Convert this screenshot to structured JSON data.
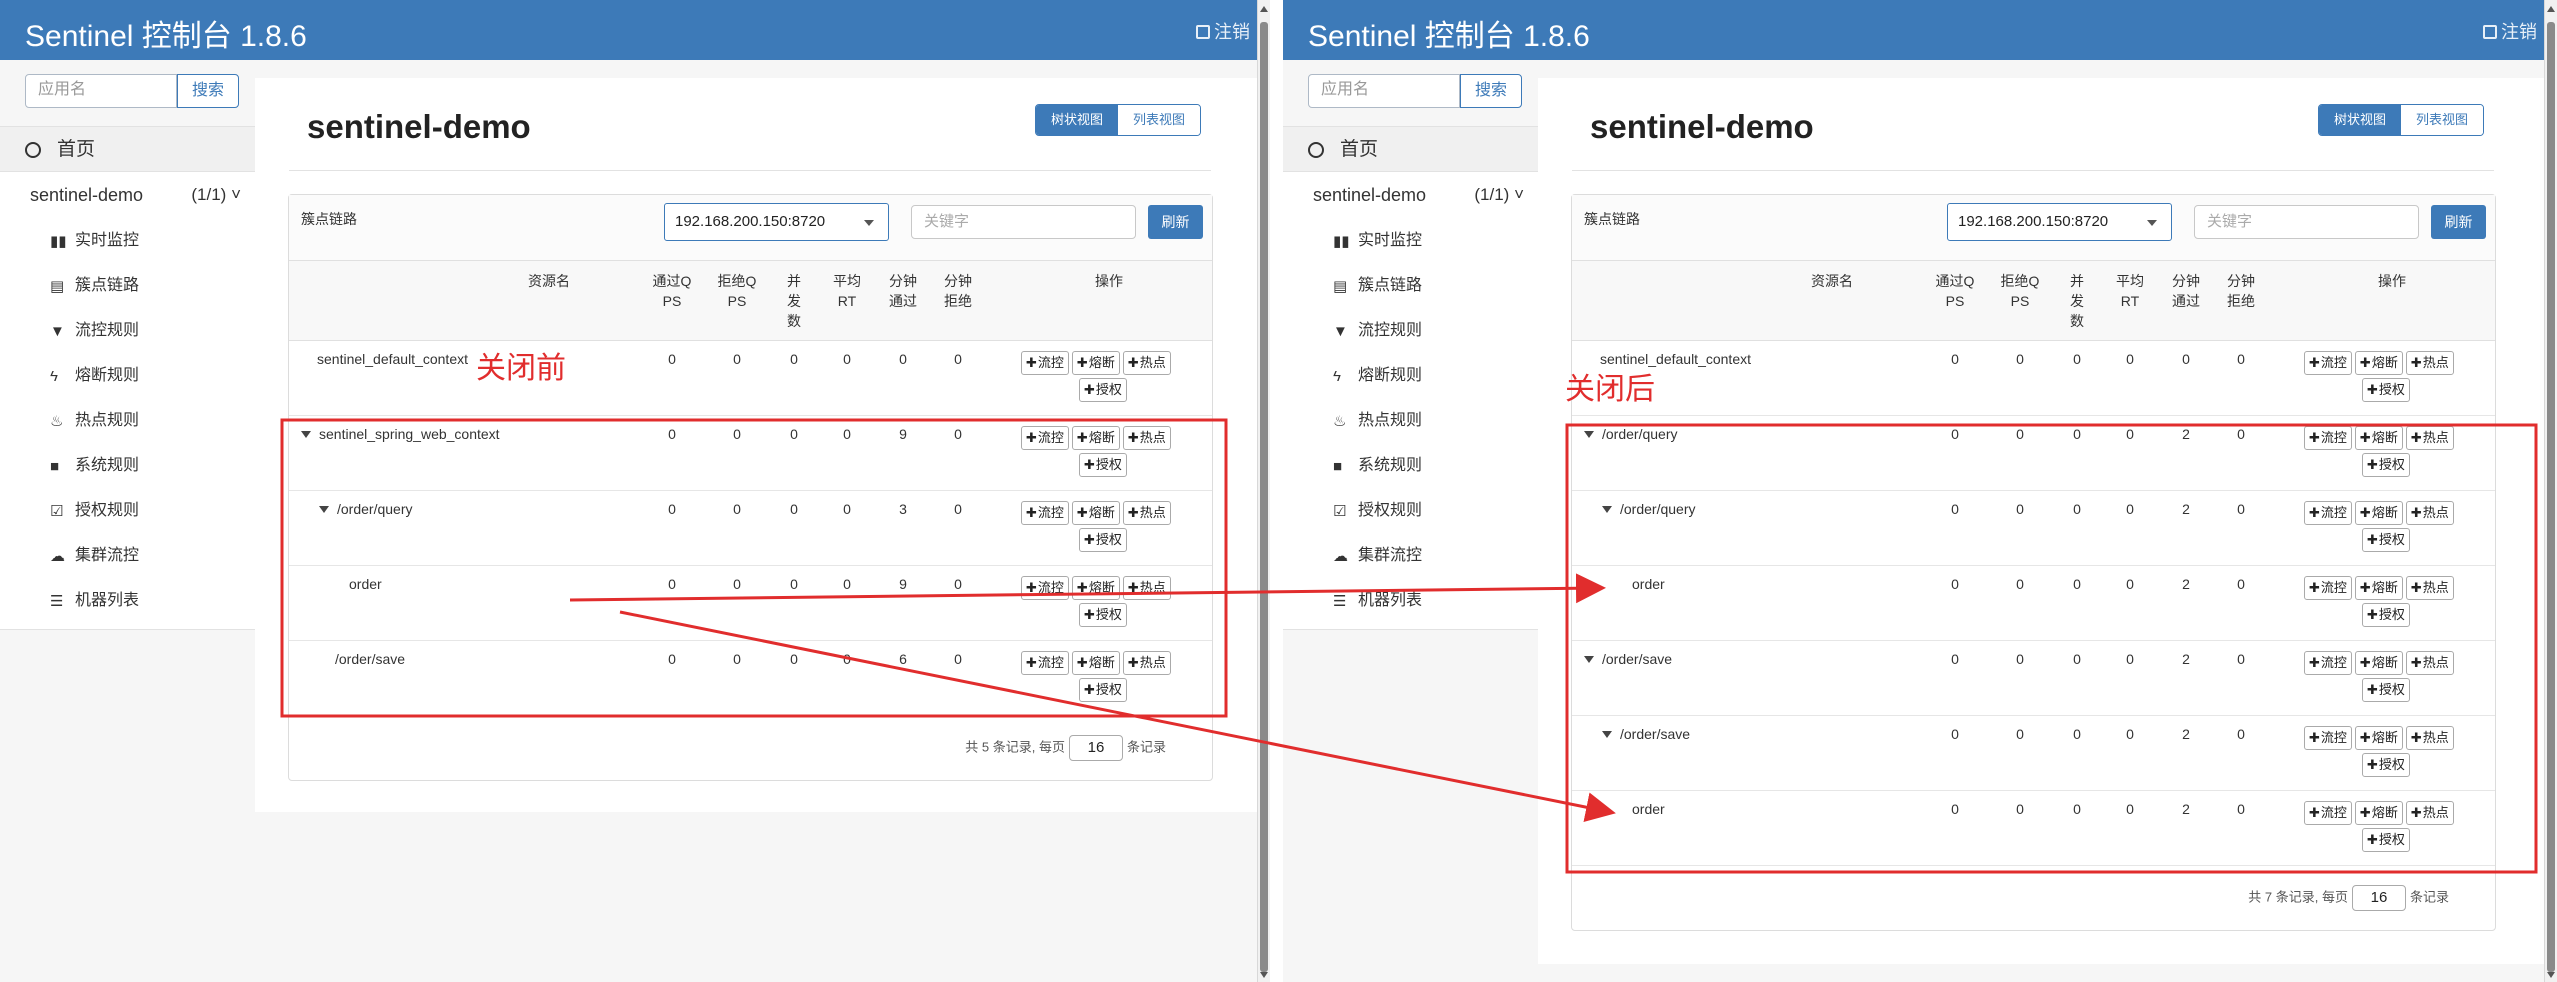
{
  "app": {
    "title": "Sentinel 控制台 1.8.6",
    "logout_label": "注销"
  },
  "sidebar": {
    "search_placeholder": "应用名",
    "search_button": "搜索",
    "home_label": "首页",
    "app_name": "sentinel-demo",
    "app_count": "(1/1)",
    "menu": [
      {
        "label": "实时监控",
        "icon": "bar-chart-icon"
      },
      {
        "label": "簇点链路",
        "icon": "list-icon"
      },
      {
        "label": "流控规则",
        "icon": "filter-icon"
      },
      {
        "label": "熔断规则",
        "icon": "bolt-icon"
      },
      {
        "label": "热点规则",
        "icon": "fire-icon"
      },
      {
        "label": "系统规则",
        "icon": "lock-icon"
      },
      {
        "label": "授权规则",
        "icon": "check-square-icon"
      },
      {
        "label": "集群流控",
        "icon": "cloud-icon"
      },
      {
        "label": "机器列表",
        "icon": "list-bullets-icon"
      }
    ]
  },
  "main": {
    "page_title": "sentinel-demo",
    "view_tabs": [
      "树状视图",
      "列表视图"
    ],
    "card_label": "簇点链路",
    "ip_selected": "192.168.200.150:8720",
    "keyword_placeholder": "关键字",
    "refresh_label": "刷新",
    "columns": {
      "name": "资源名",
      "pass_qps": [
        "通过Q",
        "PS"
      ],
      "block_qps": [
        "拒绝Q",
        "PS"
      ],
      "threads": [
        "并",
        "发",
        "数"
      ],
      "avg_rt": [
        "平均",
        "RT"
      ],
      "min_pass": [
        "分钟",
        "通过"
      ],
      "min_block": [
        "分钟",
        "拒绝"
      ],
      "ops": "操作"
    },
    "op_labels": {
      "flow": "流控",
      "degrade": "熔断",
      "hot": "热点",
      "auth": "授权"
    },
    "pager": {
      "prefix": "共",
      "suffix_per_page": "条记录, 每页",
      "page_size": "16",
      "suffix": "条记录"
    }
  },
  "before": {
    "note": "关闭前",
    "total": "5",
    "rows": [
      {
        "name": "sentinel_default_context",
        "level": 0,
        "tree": false,
        "pass_qps": "0",
        "block_qps": "0",
        "threads": "0",
        "avg_rt": "0",
        "min_pass": "0",
        "min_block": "0"
      },
      {
        "name": "sentinel_spring_web_context",
        "level": 0,
        "tree": true,
        "pass_qps": "0",
        "block_qps": "0",
        "threads": "0",
        "avg_rt": "0",
        "min_pass": "9",
        "min_block": "0"
      },
      {
        "name": "/order/query",
        "level": 1,
        "tree": true,
        "pass_qps": "0",
        "block_qps": "0",
        "threads": "0",
        "avg_rt": "0",
        "min_pass": "3",
        "min_block": "0"
      },
      {
        "name": "order",
        "level": 2,
        "tree": false,
        "pass_qps": "0",
        "block_qps": "0",
        "threads": "0",
        "avg_rt": "0",
        "min_pass": "9",
        "min_block": "0"
      },
      {
        "name": "/order/save",
        "level": 1,
        "tree": false,
        "pass_qps": "0",
        "block_qps": "0",
        "threads": "0",
        "avg_rt": "0",
        "min_pass": "6",
        "min_block": "0"
      }
    ]
  },
  "after": {
    "note": "关闭后",
    "total": "7",
    "rows": [
      {
        "name": "sentinel_default_context",
        "level": 0,
        "tree": false,
        "pass_qps": "0",
        "block_qps": "0",
        "threads": "0",
        "avg_rt": "0",
        "min_pass": "0",
        "min_block": "0"
      },
      {
        "name": "/order/query",
        "level": 0,
        "tree": true,
        "pass_qps": "0",
        "block_qps": "0",
        "threads": "0",
        "avg_rt": "0",
        "min_pass": "2",
        "min_block": "0"
      },
      {
        "name": "/order/query",
        "level": 1,
        "tree": true,
        "pass_qps": "0",
        "block_qps": "0",
        "threads": "0",
        "avg_rt": "0",
        "min_pass": "2",
        "min_block": "0"
      },
      {
        "name": "order",
        "level": 2,
        "tree": false,
        "pass_qps": "0",
        "block_qps": "0",
        "threads": "0",
        "avg_rt": "0",
        "min_pass": "2",
        "min_block": "0"
      },
      {
        "name": "/order/save",
        "level": 0,
        "tree": true,
        "pass_qps": "0",
        "block_qps": "0",
        "threads": "0",
        "avg_rt": "0",
        "min_pass": "2",
        "min_block": "0"
      },
      {
        "name": "/order/save",
        "level": 1,
        "tree": true,
        "pass_qps": "0",
        "block_qps": "0",
        "threads": "0",
        "avg_rt": "0",
        "min_pass": "2",
        "min_block": "0"
      },
      {
        "name": "order",
        "level": 2,
        "tree": false,
        "pass_qps": "0",
        "block_qps": "0",
        "threads": "0",
        "avg_rt": "0",
        "min_pass": "2",
        "min_block": "0"
      }
    ]
  },
  "colors": {
    "header_blue": "#3d7ab8",
    "annotation_red": "#e12d2d"
  }
}
